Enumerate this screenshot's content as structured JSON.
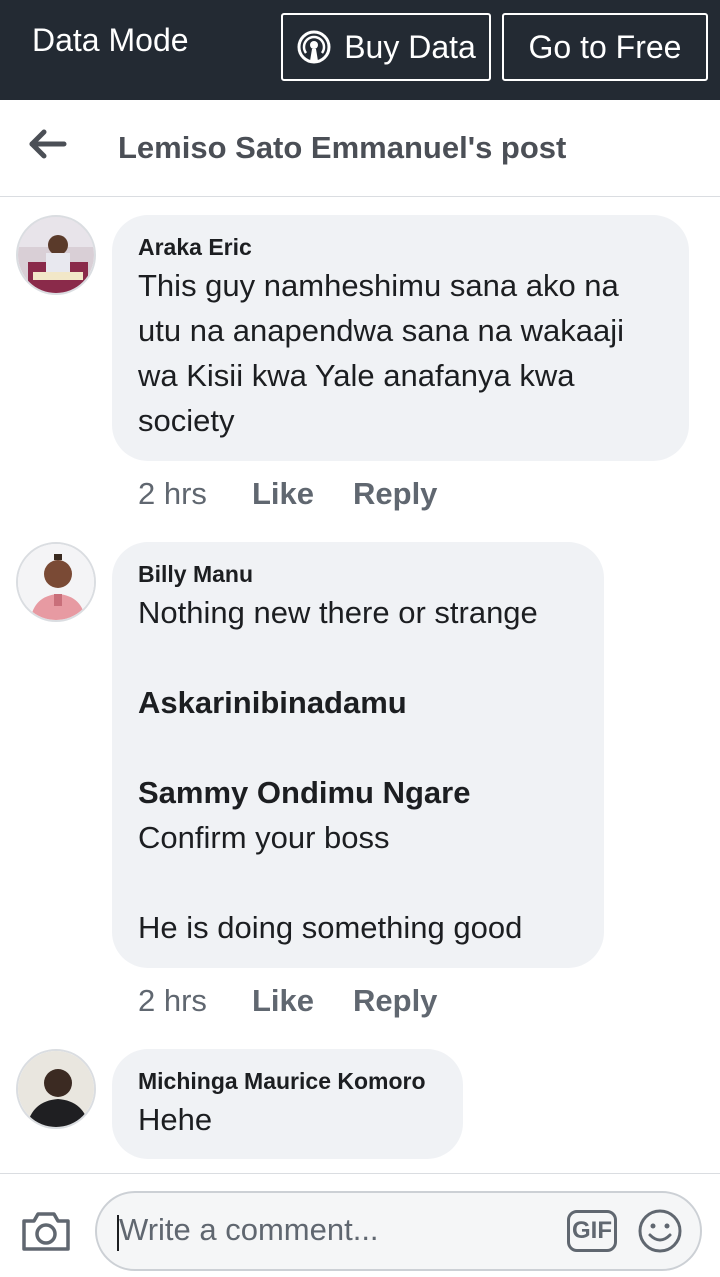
{
  "databar": {
    "mode_label": "Data Mode",
    "buy_label": "Buy Data",
    "free_label": "Go to Free"
  },
  "header": {
    "title": "Lemiso Sato Emmanuel's post"
  },
  "comments": [
    {
      "author": "Araka Eric",
      "lines": [
        "This guy namheshimu sana ako na",
        "utu na anapendwa sana na wakaaji",
        "wa Kisii kwa Yale anafanya kwa",
        "society"
      ],
      "time": "2 hrs",
      "like": "Like",
      "reply": "Reply"
    },
    {
      "author": "Billy Manu",
      "line1": "Nothing new there or strange",
      "mention1": "Askarinibinadamu",
      "mention2": "Sammy Ondimu Ngare",
      "line2": "Confirm your boss",
      "line3": "He is doing something good",
      "time": "2 hrs",
      "like": "Like",
      "reply": "Reply"
    },
    {
      "author": "Michinga Maurice Komoro",
      "lines": [
        "Hehe"
      ]
    }
  ],
  "composer": {
    "placeholder": "Write a comment...",
    "gif_label": "GIF"
  },
  "icons": {
    "back": "back-arrow-icon",
    "signal": "broadcast-icon",
    "camera": "camera-icon",
    "gif": "gif-icon",
    "emoji": "emoji-icon"
  },
  "colors": {
    "databar_bg": "#232a33",
    "bubble_bg": "#f0f2f5",
    "meta_text": "#606770"
  }
}
